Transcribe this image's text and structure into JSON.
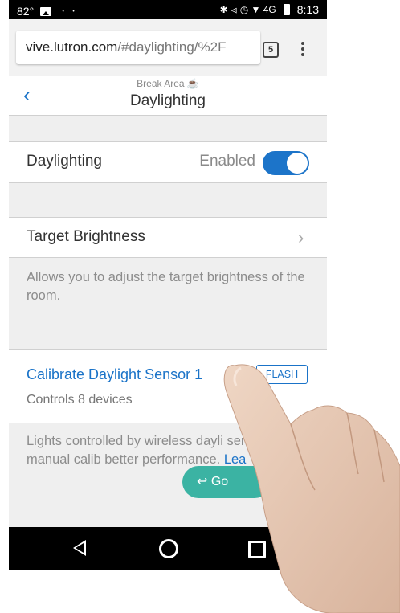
{
  "status_bar": {
    "temp": "82°",
    "voicemail": "ㆍㆍ",
    "right_icons": "✱ ⏿ ◷ ▼ 4G",
    "time": "8:13"
  },
  "browser": {
    "url_main": "vive.lutron.com",
    "url_rest": "/#daylighting/%2F",
    "tab_count": "5"
  },
  "header": {
    "back_icon": "‹",
    "subtitle": "Break Area ☕",
    "title": "Daylighting"
  },
  "daylighting_row": {
    "label": "Daylighting",
    "state": "Enabled",
    "toggle_on": true
  },
  "target_row": {
    "label": "Target Brightness",
    "chevron": "›",
    "description": "Allows you to adjust the target brightness of the room."
  },
  "calibrate_row": {
    "label": "Calibrate Daylight Sensor 1",
    "flash_label": "FLASH",
    "subtitle": "Controls 8 devices"
  },
  "calibrate_desc": {
    "text": "Lights controlled by wireless dayli sensors require manual calib better performance.",
    "link": "Lea",
    "go_label": "↩ Go"
  },
  "colors": {
    "accent": "#1a73c8",
    "toggle": "#1c74c9",
    "go_button": "#3bb3a3"
  }
}
